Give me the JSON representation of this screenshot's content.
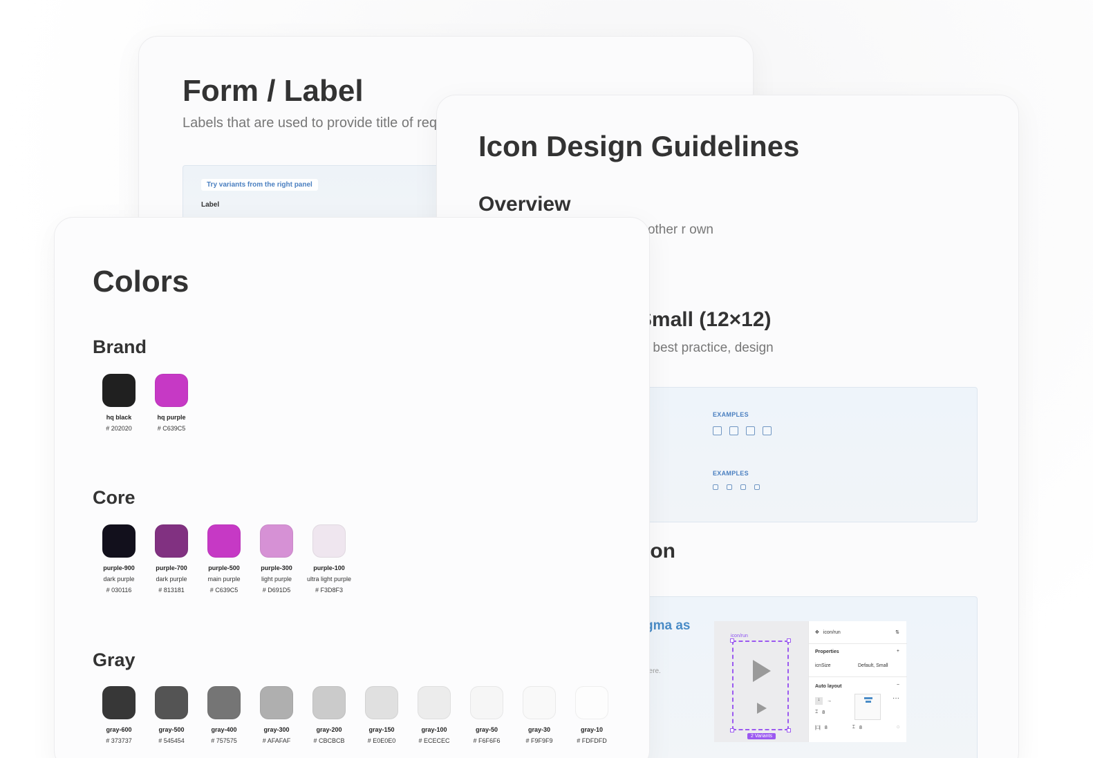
{
  "form_card": {
    "title": "Form / Label",
    "description": "Labels that are used to provide title of required or not. It is a component of Fo",
    "hint": "Try variants from the right panel",
    "sample_label": "Label"
  },
  "icon_card": {
    "title": "Icon Design Guidelines",
    "overview_heading": "Overview",
    "overview_text": "one. They thin other r own",
    "sizes_heading": "Default (20×20), Small (12×12)",
    "sizes_text": "20×20 grid or 12×12 grid. For best practice, design",
    "examples_label_1": "EXAMPLES",
    "examples_label_2": "EXAMPLES",
    "section_heading": "ion",
    "figma_title": "gma as",
    "figma_sub": "here.",
    "figma_mock": {
      "selection_label": "icon/run",
      "variants_badge": "2 Variants",
      "component_name": "icon/run",
      "properties_label": "Properties",
      "prop_name": "icnSize",
      "prop_value": "Default, Small",
      "auto_layout_label": "Auto layout",
      "spacing_1": "8",
      "spacing_2": "8",
      "spacing_3": "8",
      "more": "···"
    }
  },
  "colors_card": {
    "title": "Colors",
    "groups": {
      "brand": {
        "title": "Brand",
        "swatches": [
          {
            "name": "hq black",
            "desc": "",
            "hex": "#202020"
          },
          {
            "name": "hq purple",
            "desc": "",
            "hex": "#C639C5"
          }
        ]
      },
      "core": {
        "title": "Core",
        "swatches": [
          {
            "name": "purple-900",
            "desc": "dark purple",
            "hex": "#030116"
          },
          {
            "name": "purple-700",
            "desc": "dark purple",
            "hex": "#813181"
          },
          {
            "name": "purple-500",
            "desc": "main purple",
            "hex": "#C639C5"
          },
          {
            "name": "purple-300",
            "desc": "light purple",
            "hex": "#D691D5"
          },
          {
            "name": "purple-100",
            "desc": "ultra light purple",
            "hex": "#F3D8F3"
          }
        ]
      },
      "gray": {
        "title": "Gray",
        "swatches": [
          {
            "name": "gray-600",
            "desc": "",
            "hex": "#373737"
          },
          {
            "name": "gray-500",
            "desc": "",
            "hex": "#545454"
          },
          {
            "name": "gray-400",
            "desc": "",
            "hex": "#757575"
          },
          {
            "name": "gray-300",
            "desc": "",
            "hex": "#AFAFAF"
          },
          {
            "name": "gray-200",
            "desc": "",
            "hex": "#CBCBCB"
          },
          {
            "name": "gray-150",
            "desc": "",
            "hex": "#E0E0E0"
          },
          {
            "name": "gray-100",
            "desc": "",
            "hex": "#ECECEC"
          },
          {
            "name": "gray-50",
            "desc": "",
            "hex": "#F6F6F6"
          },
          {
            "name": "gray-30",
            "desc": "",
            "hex": "#F9F9F9"
          },
          {
            "name": "gray-10",
            "desc": "",
            "hex": "#FDFDFD"
          }
        ]
      }
    },
    "swatch_colors": {
      "hq black": "#202020",
      "hq purple": "#C639C5",
      "purple-900": "#12101c",
      "purple-700": "#813181",
      "purple-500": "#C639C5",
      "purple-300": "#D691D5",
      "purple-100": "#EFE6EF"
    }
  }
}
